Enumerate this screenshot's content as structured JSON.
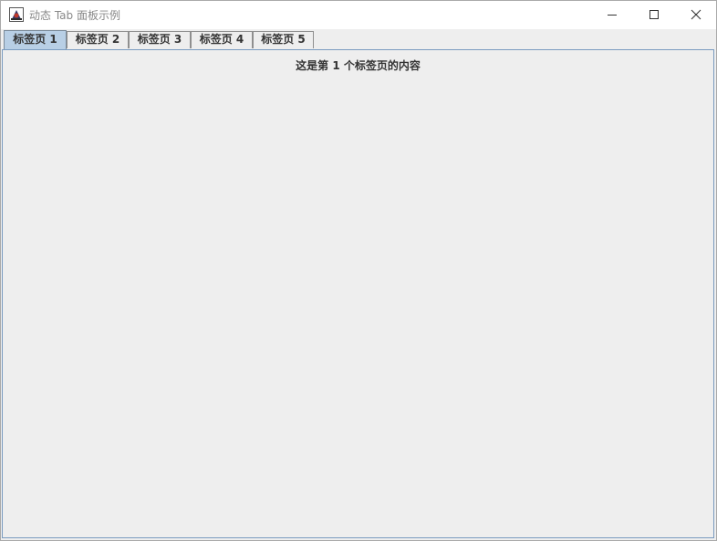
{
  "window": {
    "title": "动态 Tab 面板示例",
    "icon": "java-app-icon",
    "controls": {
      "minimize": "minimize-icon",
      "maximize": "maximize-icon",
      "close": "close-icon"
    }
  },
  "tabs": [
    {
      "label": "标签页 1",
      "selected": true
    },
    {
      "label": "标签页 2",
      "selected": false
    },
    {
      "label": "标签页 3",
      "selected": false
    },
    {
      "label": "标签页 4",
      "selected": false
    },
    {
      "label": "标签页 5",
      "selected": false
    }
  ],
  "content": {
    "text": "这是第 1 个标签页的内容"
  },
  "colors": {
    "selected_tab": "#b8cfe5",
    "panel_background": "#eeeeee",
    "panel_border": "#7a9bc0"
  }
}
